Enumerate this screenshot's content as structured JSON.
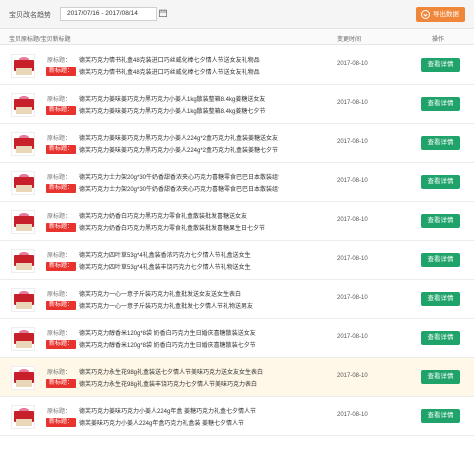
{
  "toolbar": {
    "label": "宝贝改名趋势",
    "date_range": "2017/07/16 - 2017/08/14",
    "export_label": "导出数据"
  },
  "table": {
    "headers": [
      "宝贝原标题/宝贝新标题",
      "变更时间",
      "操作"
    ],
    "old_tag": "原标题：",
    "new_tag": "新标题：",
    "detail_label": "查看详情",
    "rows": [
      {
        "old_title": "德芙巧克力情书礼盒48克装进口巧丝威化棒七夕情人节送女友礼物品",
        "new_title": "德芙巧克力情书礼盒48克装进口巧丝威化棒七夕情人节送女友礼物品",
        "date": "2017-08-10"
      },
      {
        "old_title": "德芙巧克力姜味姜巧克力黑巧克力小姜人1kg散装整箱8.4kg姜糖送女友",
        "new_title": "德芙巧克力姜味姜巧克力黑巧克力小姜人1kg散装整箱8.4kg姜糖七夕节",
        "date": "2017-08-10"
      },
      {
        "old_title": "德芙巧克力姜味姜巧克力黑巧克力小姜人224g*2盒巧克力礼盒装姜糖送女友",
        "new_title": "德芙巧克力姜味姜巧克力黑巧克力小姜人224g*2盒巧克力礼盒装姜糖七夕节",
        "date": "2017-08-10"
      },
      {
        "old_title": "德芙巧克力士力架20g*30牛奶香甜香浓夹心巧克力喜糖零食巴巴日本散装组合送女友",
        "new_title": "德芙巧克力士力架20g*30牛奶香甜香浓夹心巧克力喜糖零食巴巴日本散装组合七夕节",
        "date": "2017-08-10"
      },
      {
        "old_title": "德芙巧克力奶香白巧克力黑巧克力零食礼盒散装批发喜糖送女友",
        "new_title": "德芙巧克力奶香白巧克力黑巧克力零食礼盒散装批发喜糖果生日七夕节",
        "date": "2017-08-10"
      },
      {
        "old_title": "德芙巧克力四叶草53g*4礼盒装香浓巧克力七夕情人节礼盒送女生",
        "new_title": "德芙巧克力四叶草53g*4礼盒装丰饶巧克力七夕情人节礼物送女生",
        "date": "2017-08-10"
      },
      {
        "old_title": "德芙巧克力一心一意子斤装巧克力礼盒批发送女友送女生表白",
        "new_title": "德芙巧克力一心一意子斤装巧克力礼盒批发七夕情人节礼物送男友",
        "date": "2017-08-10"
      },
      {
        "old_title": "德芙巧克力醇香米120g*8袋 奶香白巧克力生日婚庆喜糖散装送女友",
        "new_title": "德芙巧克力醇香米120g*8袋 奶香白巧克力生日婚庆喜糖散装七夕节",
        "date": "2017-08-10"
      },
      {
        "old_title": "德芙巧克力永生花98g礼盒装送七夕情人节美味巧克力送女友女生表白",
        "new_title": "德芙巧克力永生花98g礼盒装丰饶巧克力七夕情人节美味巧克力表白",
        "date": "2017-08-10"
      },
      {
        "old_title": "德芙巧克力姜味巧克力小姜人224g年盒 姜糖巧克力礼盒七夕情人节",
        "new_title": "德芙姜味巧克力小姜人224g年盒巧克力礼盒装 姜糖七夕情人节",
        "date": "2017-08-10"
      }
    ]
  },
  "colors": {
    "export_bg": "#f0863a",
    "detail_bg": "#1fa36a",
    "new_tag_bg": "#e8322e",
    "highlight_row_bg": "#fff8e8"
  },
  "icons": [
    "calendar-icon",
    "download-icon",
    "product-thumbnail"
  ]
}
